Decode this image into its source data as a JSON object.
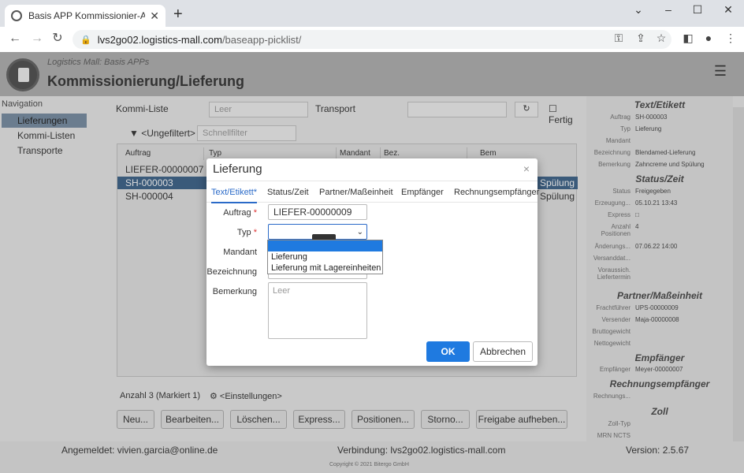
{
  "browser": {
    "tab_title": "Basis APP Kommissionier-Auftrag",
    "url_host": "lvs2go02.logistics-mall.com",
    "url_path": "/baseapp-picklist/"
  },
  "app": {
    "brand": "Logistics Mall: Basis APPs",
    "title": "Kommissionierung/Lieferung"
  },
  "nav": {
    "header": "Navigation",
    "items": [
      "Lieferungen",
      "Kommi-Listen",
      "Transporte"
    ]
  },
  "toolbar": {
    "kommi_label": "Kommi-Liste",
    "kommi_placeholder": "Leer",
    "transport_label": "Transport",
    "fertig_label": "Fertig",
    "filter_label": "<Ungefiltert>",
    "quickfilter_placeholder": "Schnellfilter"
  },
  "grid": {
    "columns": [
      "Auftrag",
      "Typ",
      "Mandant",
      "Bez.",
      "Bem"
    ],
    "rows": [
      "LIEFER-00000007",
      "SH-000003",
      "SH-000004"
    ],
    "row_extra": [
      "Spülung",
      "Spülung"
    ],
    "count_text": "Anzahl 3 (Markiert 1)",
    "settings_label": "<Einstellungen>"
  },
  "buttons": [
    "Neu...",
    "Bearbeiten...",
    "Löschen...",
    "Express...",
    "Positionen...",
    "Storno...",
    "Freigabe aufheben..."
  ],
  "sidebar": {
    "sections": [
      {
        "title": "Text/Etikett",
        "rows": [
          [
            "Auftrag",
            "SH-000003"
          ],
          [
            "Typ",
            "Lieferung"
          ],
          [
            "Mandant",
            ""
          ],
          [
            "Bezeichnung",
            "Blendamed-Lieferung"
          ],
          [
            "Bemerkung",
            "Zahncreme und Spülung"
          ]
        ]
      },
      {
        "title": "Status/Zeit",
        "rows": [
          [
            "Status",
            "Freigegeben"
          ],
          [
            "Erzeugung...",
            "05.10.21 13:43"
          ],
          [
            "Express",
            "□"
          ],
          [
            "Anzahl Positionen",
            "4"
          ],
          [
            "Änderungs...",
            "07.06.22 14:00"
          ],
          [
            "Versanddat...",
            ""
          ],
          [
            "Voraussich. Liefertermin",
            ""
          ]
        ]
      },
      {
        "title": "Partner/Maßeinheit",
        "rows": [
          [
            "Frachtführer",
            "UPS-00000009"
          ],
          [
            "Versender",
            "Maja-00000008"
          ],
          [
            "Bruttogewicht",
            ""
          ],
          [
            "Nettogewicht",
            ""
          ]
        ]
      },
      {
        "title": "Empfänger",
        "rows": [
          [
            "Empfänger",
            "Meyer-00000007"
          ]
        ]
      },
      {
        "title": "Rechnungsempfänger",
        "rows": [
          [
            "Rechnungs...",
            ""
          ]
        ]
      },
      {
        "title": "Zoll",
        "rows": [
          [
            "Zoll-Typ",
            ""
          ],
          [
            "MRN NCTS",
            ""
          ]
        ]
      }
    ]
  },
  "footer": {
    "user": "Angemeldet: vivien.garcia@online.de",
    "connection": "Verbindung: lvs2go02.logistics-mall.com",
    "version": "Version: 2.5.67",
    "copyright": "Copyright © 2021 Bitergo GmbH"
  },
  "modal": {
    "title": "Lieferung",
    "close": "×",
    "tabs": [
      "Text/Etikett*",
      "Status/Zeit",
      "Partner/Maßeinheit",
      "Empfänger",
      "Rechnungsempfänger"
    ],
    "fields": {
      "auftrag_label": "Auftrag",
      "auftrag_value": "LIEFER-00000009",
      "typ_label": "Typ",
      "mandant_label": "Mandant",
      "bezeichnung_label": "Bezeichnung",
      "bemerkung_label": "Bemerkung",
      "bemerkung_placeholder": "Leer",
      "required_mark": "*"
    },
    "typ_options": [
      "Lieferung",
      "Lieferung mit Lagereinheiten"
    ],
    "ok": "OK",
    "cancel": "Abbrechen"
  }
}
